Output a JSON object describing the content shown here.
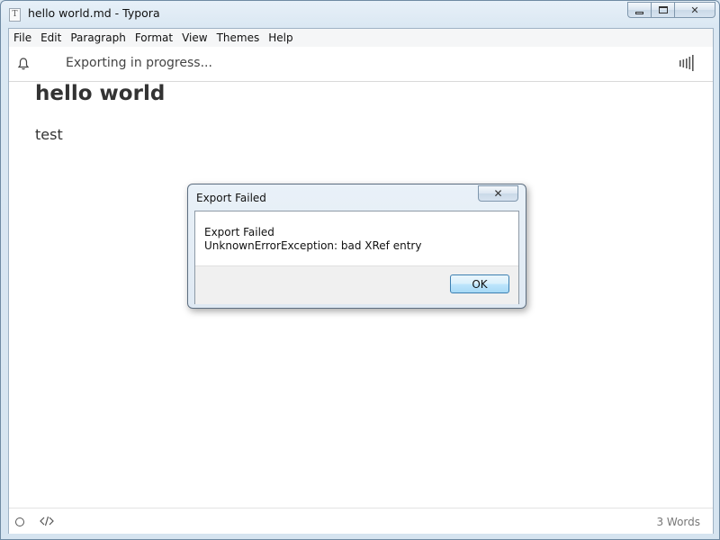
{
  "window": {
    "title": "hello world.md - Typora",
    "app_icon_glyph": "T",
    "controls": {
      "close_glyph": "✕"
    }
  },
  "menubar": {
    "items": [
      "File",
      "Edit",
      "Paragraph",
      "Format",
      "View",
      "Themes",
      "Help"
    ]
  },
  "notice_bar": {
    "icon": "bell-icon",
    "text": "Exporting in progress...",
    "right_icon": "progress-indicator-icon"
  },
  "document": {
    "heading": "hello world",
    "paragraph": "test"
  },
  "statusbar": {
    "left_icons": [
      "circle-icon",
      "code-icon"
    ],
    "word_count": "3 Words"
  },
  "dialog": {
    "title": "Export Failed",
    "close_glyph": "✕",
    "message_line1": "Export Failed",
    "message_line2": "UnknownErrorException: bad XRef entry",
    "ok_label": "OK"
  }
}
